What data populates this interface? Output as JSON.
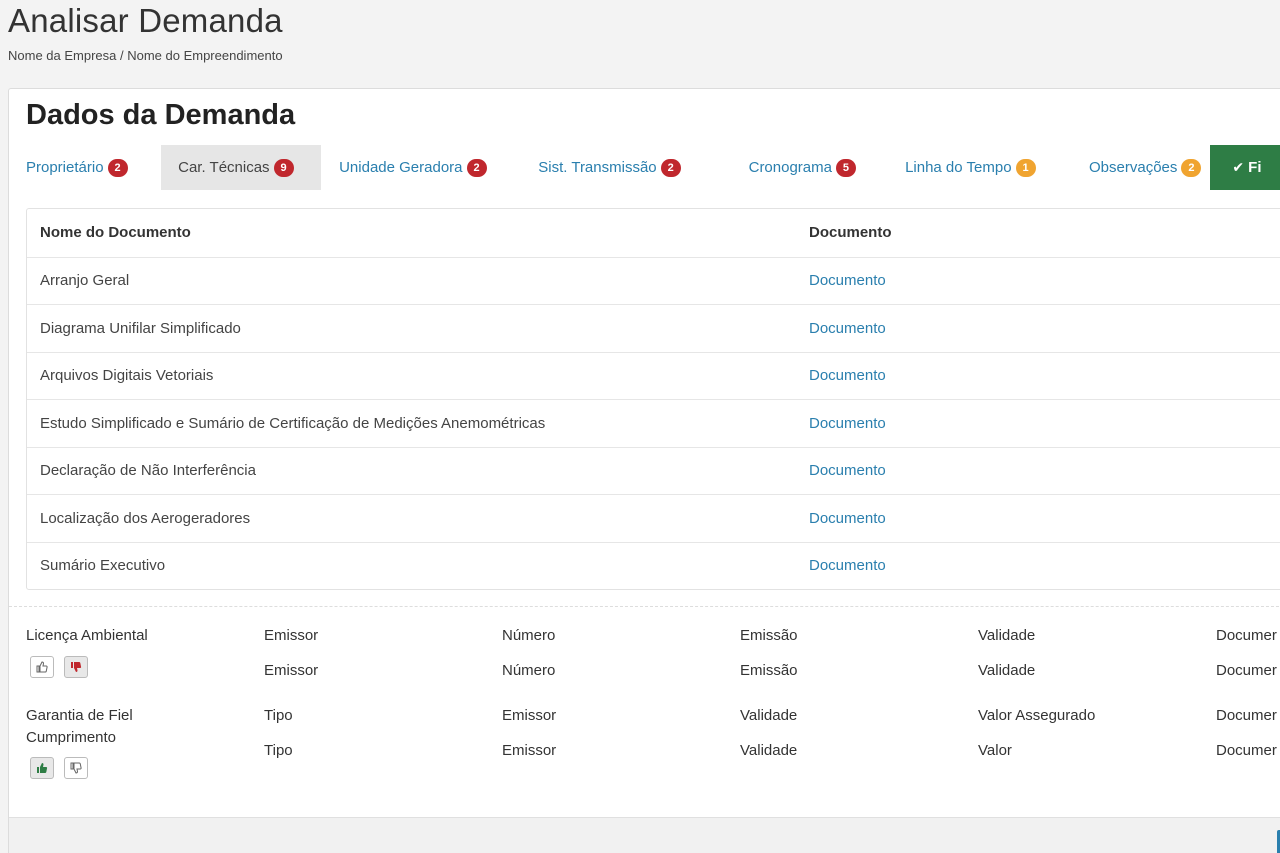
{
  "header": {
    "title": "Analisar Demanda",
    "breadcrumb": "Nome da Empresa / Nome do Empreendimento"
  },
  "panel": {
    "title": "Dados da Demanda"
  },
  "tabs": [
    {
      "label": "Proprietário",
      "count": "2",
      "badge_color": "red"
    },
    {
      "label": "Car. Técnicas",
      "count": "9",
      "badge_color": "red",
      "active": true
    },
    {
      "label": "Unidade Geradora",
      "count": "2",
      "badge_color": "red"
    },
    {
      "label": "Sist. Transmissão",
      "count": "2",
      "badge_color": "red"
    },
    {
      "label": "Cronograma",
      "count": "5",
      "badge_color": "red"
    },
    {
      "label": "Linha do Tempo",
      "count": "1",
      "badge_color": "orange"
    },
    {
      "label": "Observações",
      "count": "2",
      "badge_color": "orange"
    }
  ],
  "finish_tab": {
    "label": "Fi",
    "icon": "check-icon"
  },
  "documents": {
    "headers": {
      "name": "Nome do Documento",
      "doc": "Documento"
    },
    "rows": [
      {
        "name": "Arranjo Geral",
        "doc": "Documento"
      },
      {
        "name": "Diagrama Unifilar Simplificado",
        "doc": "Documento"
      },
      {
        "name": "Arquivos Digitais Vetoriais",
        "doc": "Documento"
      },
      {
        "name": "Estudo Simplificado e Sumário de Certificação de Medições Anemométricas",
        "doc": "Documento"
      },
      {
        "name": "Declaração de Não Interferência",
        "doc": "Documento"
      },
      {
        "name": "Localização dos Aerogeradores",
        "doc": "Documento"
      },
      {
        "name": "Sumário Executivo",
        "doc": "Documento"
      }
    ]
  },
  "licenca": {
    "title": "Licença Ambiental",
    "cols": [
      {
        "label": "Emissor",
        "value": "Emissor"
      },
      {
        "label": "Número",
        "value": "Número"
      },
      {
        "label": "Emissão",
        "value": "Emissão"
      },
      {
        "label": "Validade",
        "value": "Validade"
      },
      {
        "label": "Documer",
        "value": "Documer"
      }
    ]
  },
  "garantia": {
    "title_line1": "Garantia de Fiel",
    "title_line2": "Cumprimento",
    "cols": [
      {
        "label": "Tipo",
        "value": "Tipo"
      },
      {
        "label": "Emissor",
        "value": "Emissor"
      },
      {
        "label": "Validade",
        "value": "Validade"
      },
      {
        "label": "Valor Assegurado",
        "value": "Valor"
      },
      {
        "label": "Documer",
        "value": "Documer"
      }
    ]
  },
  "colors": {
    "link": "#2a7fae",
    "badge_red": "#c0272d",
    "badge_orange": "#f0a430",
    "finish_green": "#2e7d45"
  }
}
